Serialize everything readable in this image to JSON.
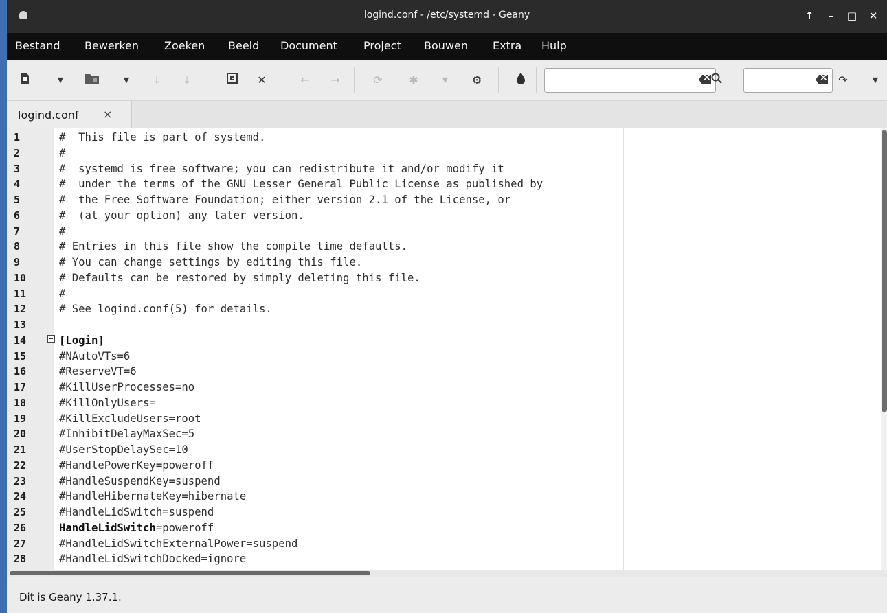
{
  "window": {
    "title": "logind.conf - /etc/systemd - Geany",
    "controls": {
      "keep_above": "↑",
      "minimize": "–",
      "maximize": "□",
      "close": "✕"
    }
  },
  "menu": [
    "Bestand",
    "Bewerken",
    "Zoeken",
    "Beeld",
    "Document",
    "Project",
    "Bouwen",
    "Extra",
    "Hulp"
  ],
  "toolbar": {
    "icons": {
      "new": "new-file-icon",
      "open": "open-folder-icon",
      "save": "save-icon",
      "save_all": "save-all-icon",
      "revert": "revert-icon",
      "close": "close-icon",
      "back": "back-arrow-icon",
      "forward": "forward-arrow-icon",
      "compile": "compile-icon",
      "build": "build-gear-icon",
      "run": "run-icon",
      "color": "color-drop-icon",
      "search": "search-icon",
      "goto": "goto-line-icon"
    },
    "search_value": "",
    "goto_value": ""
  },
  "tab": {
    "label": "logind.conf",
    "close": "×"
  },
  "editor": {
    "lines": [
      {
        "n": "1",
        "text": "#  This file is part of systemd."
      },
      {
        "n": "2",
        "text": "#"
      },
      {
        "n": "3",
        "text": "#  systemd is free software; you can redistribute it and/or modify it"
      },
      {
        "n": "4",
        "text": "#  under the terms of the GNU Lesser General Public License as published by"
      },
      {
        "n": "5",
        "text": "#  the Free Software Foundation; either version 2.1 of the License, or"
      },
      {
        "n": "6",
        "text": "#  (at your option) any later version."
      },
      {
        "n": "7",
        "text": "#"
      },
      {
        "n": "8",
        "text": "# Entries in this file show the compile time defaults."
      },
      {
        "n": "9",
        "text": "# You can change settings by editing this file."
      },
      {
        "n": "10",
        "text": "# Defaults can be restored by simply deleting this file."
      },
      {
        "n": "11",
        "text": "#"
      },
      {
        "n": "12",
        "text": "# See logind.conf(5) for details."
      },
      {
        "n": "13",
        "text": ""
      },
      {
        "n": "14",
        "text": "[Login]"
      },
      {
        "n": "15",
        "text": "#NAutoVTs=6"
      },
      {
        "n": "16",
        "text": "#ReserveVT=6"
      },
      {
        "n": "17",
        "text": "#KillUserProcesses=no"
      },
      {
        "n": "18",
        "text": "#KillOnlyUsers="
      },
      {
        "n": "19",
        "text": "#KillExcludeUsers=root"
      },
      {
        "n": "20",
        "text": "#InhibitDelayMaxSec=5"
      },
      {
        "n": "21",
        "text": "#UserStopDelaySec=10"
      },
      {
        "n": "22",
        "text": "#HandlePowerKey=poweroff"
      },
      {
        "n": "23",
        "text": "#HandleSuspendKey=suspend"
      },
      {
        "n": "24",
        "text": "#HandleHibernateKey=hibernate"
      },
      {
        "n": "25",
        "text": "#HandleLidSwitch=suspend"
      },
      {
        "n": "26",
        "key": "HandleLidSwitch",
        "value": "=poweroff"
      },
      {
        "n": "27",
        "text": "#HandleLidSwitchExternalPower=suspend"
      },
      {
        "n": "28",
        "text": "#HandleLidSwitchDocked=ignore"
      }
    ]
  },
  "status": {
    "text": "Dit is Geany 1.37.1."
  }
}
